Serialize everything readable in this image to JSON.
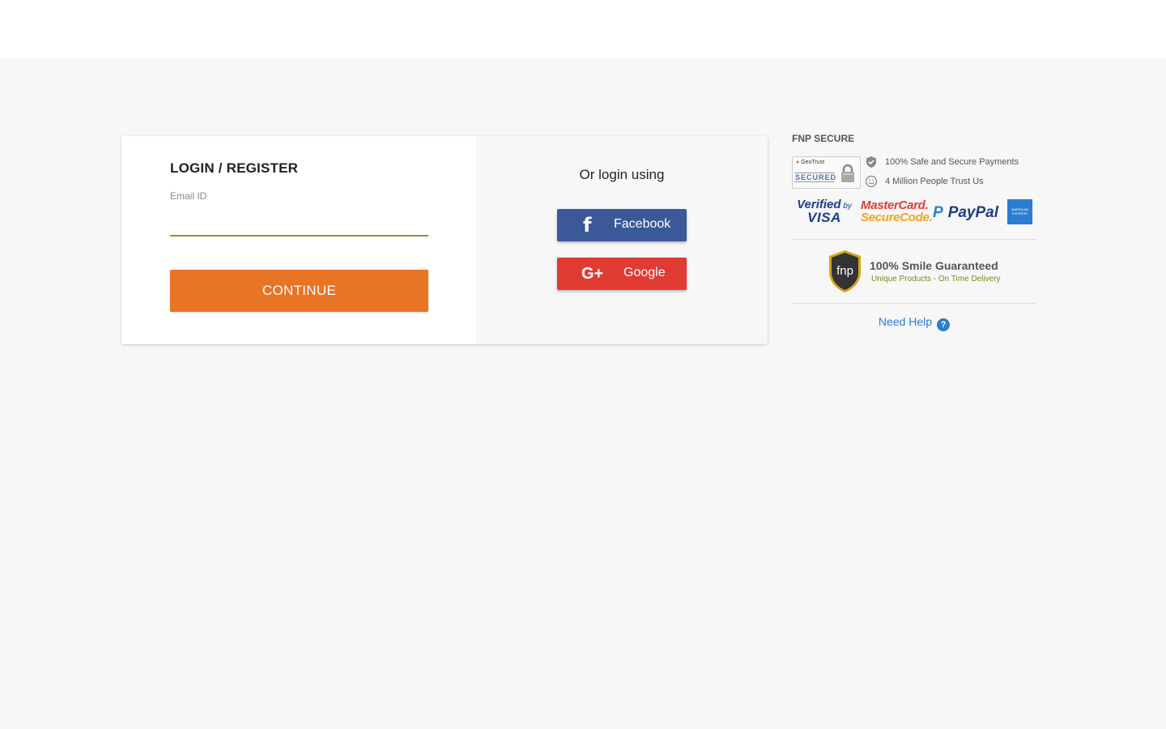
{
  "login": {
    "title": "LOGIN / REGISTER",
    "email_label": "Email ID",
    "email_value": "",
    "continue_label": "CONTINUE"
  },
  "social": {
    "heading": "Or login using",
    "facebook_label": "Facebook",
    "google_label": "Google",
    "google_icon_text": "G+",
    "facebook_icon_text": "f"
  },
  "secure": {
    "title": "FNP SECURE",
    "geotrust_brand": "GeoTrust",
    "geotrust_secured": "SECURED",
    "trust_lines": [
      "100% Safe and Secure Payments",
      "4 Million People Trust Us"
    ],
    "payment_logos": {
      "visa_line1": "Verified",
      "visa_by": "by",
      "visa_line2": "VISA",
      "mastercard_line1": "MasterCard.",
      "mastercard_line2": "SecureCode.",
      "paypal": "PayPal",
      "amex": "AMERICAN EXPRESS"
    },
    "smile_title": "100% Smile Guaranteed",
    "smile_subtitle": "Unique Products - On Time Delivery",
    "shield_text": "fnp",
    "need_help": "Need Help",
    "help_icon_text": "?"
  },
  "colors": {
    "accent_orange": "#e87425",
    "facebook_blue": "#3b5998",
    "google_red": "#e03b33",
    "link_blue": "#2a7dd1",
    "input_underline": "#7a9a2e"
  }
}
